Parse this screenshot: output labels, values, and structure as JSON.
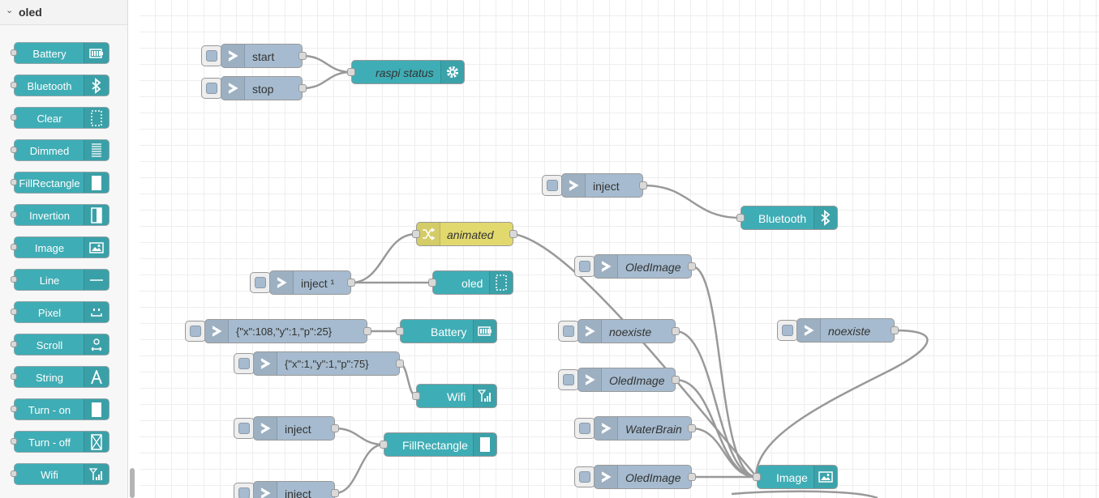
{
  "palette": {
    "category": "oled",
    "nodes": [
      {
        "label": "Battery",
        "icon": "battery-icon"
      },
      {
        "label": "Bluetooth",
        "icon": "bluetooth-icon"
      },
      {
        "label": "Clear",
        "icon": "clear-icon"
      },
      {
        "label": "Dimmed",
        "icon": "dimmed-icon"
      },
      {
        "label": "FillRectangle",
        "icon": "fill-rectangle-icon"
      },
      {
        "label": "Invertion",
        "icon": "invertion-icon"
      },
      {
        "label": "Image",
        "icon": "image-icon"
      },
      {
        "label": "Line",
        "icon": "line-icon"
      },
      {
        "label": "Pixel",
        "icon": "pixel-icon"
      },
      {
        "label": "Scroll",
        "icon": "scroll-icon"
      },
      {
        "label": "String",
        "icon": "string-icon"
      },
      {
        "label": "Turn - on",
        "icon": "turn-on-icon"
      },
      {
        "label": "Turn - off",
        "icon": "turn-off-icon"
      },
      {
        "label": "Wifi",
        "icon": "wifi-icon"
      }
    ]
  },
  "flow": {
    "inject_start": "start",
    "inject_stop": "stop",
    "raspi_status": "raspi status",
    "inject_bluetooth": "inject",
    "bluetooth": "Bluetooth",
    "animated": "animated",
    "inject_1": "inject ¹",
    "oled_clear": "oled",
    "inject_battery": "{\"x\":108,\"y\":1,\"p\":25}",
    "battery": "Battery",
    "inject_wifi": "{\"x\":1,\"y\":1,\"p\":75}",
    "wifi": "Wifi",
    "inject_fill_1": "inject",
    "fill_rectangle": "FillRectangle",
    "inject_fill_2": "inject",
    "inject_oledimage_1": "OledImage",
    "inject_noexiste_1": "noexiste",
    "inject_oledimage_2": "OledImage",
    "inject_waterbrain": "WaterBrain",
    "inject_oledimage_3": "OledImage",
    "inject_noexiste_2": "noexiste",
    "image": "Image"
  },
  "colors": {
    "oled_node": "#3fadb5",
    "inject_node": "#a6bbcf",
    "change_node": "#e2d96e",
    "wire": "#999999"
  }
}
